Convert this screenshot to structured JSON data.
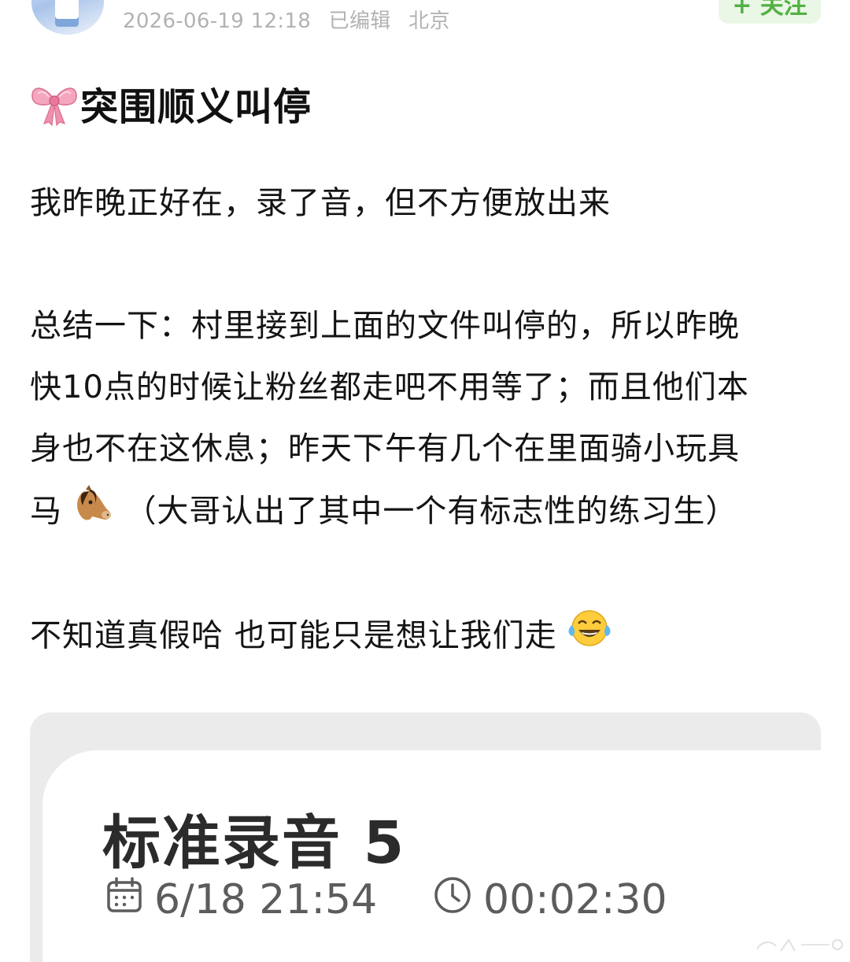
{
  "header": {
    "timestamp": "2026-06-19 12:18",
    "edited_label": "已编辑",
    "location": "北京",
    "follow_label": "+ 关注"
  },
  "post": {
    "title": "突围顺义叫停",
    "title_icon": "ribbon-bow-icon",
    "lines": [
      "我昨晚正好在，录了音，但不方便放出来",
      "总结一下：村里接到上面的文件叫停的，所以昨晚",
      "快10点的时候让粉丝都走吧不用等了；而且他们本",
      "身也不在这休息；昨天下午有几个在里面骑小玩具",
      "马",
      "（大哥认出了其中一个有标志性的练习生）",
      "不知道真假哈 也可能只是想让我们走"
    ],
    "inline_emoji": [
      "horse-face-emoji",
      "tears-of-joy-emoji"
    ]
  },
  "recording_card": {
    "name": "标准录音 5",
    "date": "6/18 21:54",
    "duration": "00:02:30",
    "date_icon": "calendar-icon",
    "duration_icon": "clock-icon"
  },
  "colors": {
    "meta_text": "#b2b2b2",
    "follow_bg": "#eaf7e6",
    "follow_text": "#52b044",
    "card_bg": "#ebebeb"
  }
}
